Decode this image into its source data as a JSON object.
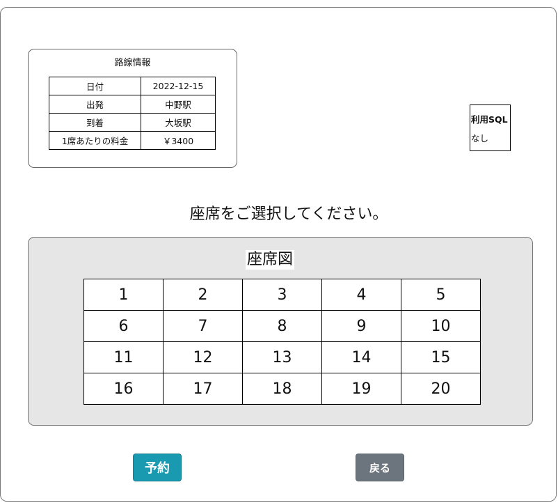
{
  "route": {
    "title": "路線情報",
    "rows": [
      {
        "label": "日付",
        "value": "2022-12-15"
      },
      {
        "label": "出発",
        "value": "中野駅"
      },
      {
        "label": "到着",
        "value": "大坂駅"
      },
      {
        "label": "1席あたりの料金",
        "value": "￥3400"
      }
    ]
  },
  "sql": {
    "title": "利用SQL",
    "value": "なし"
  },
  "instruction": "座席をご選択してください。",
  "seat_map": {
    "title": "座席図",
    "rows": [
      [
        "1",
        "2",
        "3",
        "4",
        "5"
      ],
      [
        "6",
        "7",
        "8",
        "9",
        "10"
      ],
      [
        "11",
        "12",
        "13",
        "14",
        "15"
      ],
      [
        "16",
        "17",
        "18",
        "19",
        "20"
      ]
    ]
  },
  "buttons": {
    "reserve": "予約",
    "back": "戻る"
  },
  "colors": {
    "reserve_button": "#1a9ab0",
    "back_button": "#6c757d",
    "seat_panel_bg": "#e6e6e6"
  }
}
